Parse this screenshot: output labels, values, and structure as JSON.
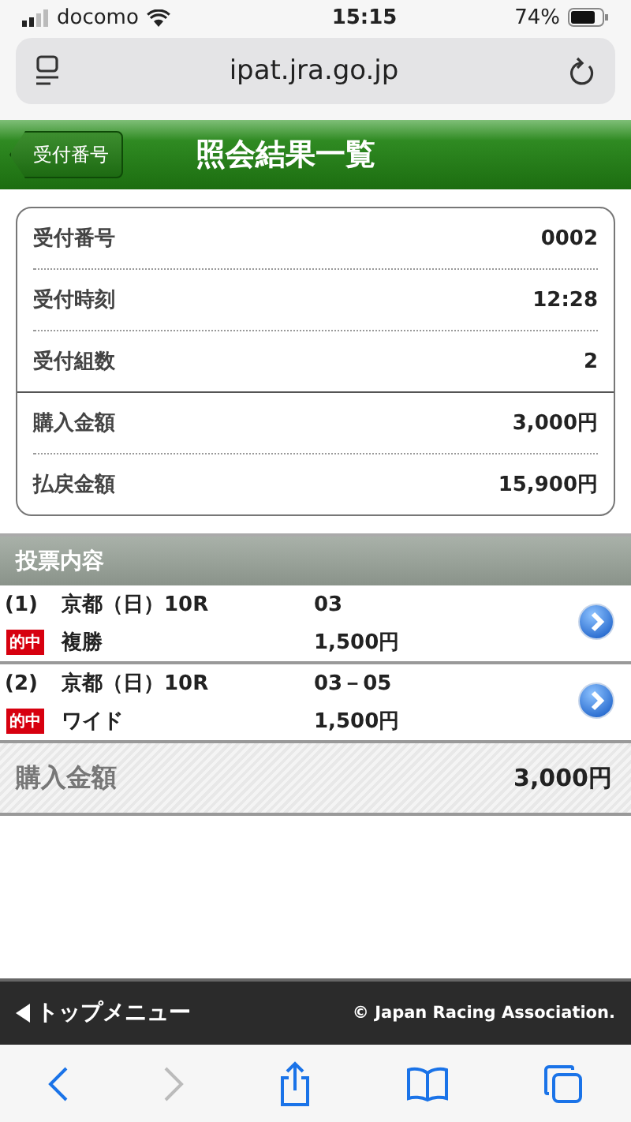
{
  "status_bar": {
    "carrier": "docomo",
    "time": "15:15",
    "battery": "74%"
  },
  "address_bar": {
    "url": "ipat.jra.go.jp"
  },
  "header": {
    "back_button": "受付番号",
    "title": "照会結果一覧"
  },
  "summary": {
    "reception": [
      {
        "label": "受付番号",
        "value": "0002"
      },
      {
        "label": "受付時刻",
        "value": "12:28"
      },
      {
        "label": "受付組数",
        "value": "2"
      }
    ],
    "amounts": [
      {
        "label": "購入金額",
        "value": "3,000円"
      },
      {
        "label": "払戻金額",
        "value": "15,900円"
      }
    ]
  },
  "section_title": "投票内容",
  "bets": [
    {
      "number": "(1)",
      "race": "京都（日）10R",
      "badge": "的中",
      "bet_type": "複勝",
      "combination": "03",
      "amount": "1,500円"
    },
    {
      "number": "(2)",
      "race": "京都（日）10R",
      "badge": "的中",
      "bet_type": "ワイド",
      "combination": "03－05",
      "amount": "1,500円"
    }
  ],
  "total": {
    "label": "購入金額",
    "value": "3,000円"
  },
  "footer": {
    "menu_link": "トップメニュー",
    "copyright": "© Japan Racing Association."
  },
  "toolbar": [
    {
      "kind": "back",
      "disabled": false
    },
    {
      "kind": "forward",
      "disabled": true
    },
    {
      "kind": "share",
      "disabled": false
    },
    {
      "kind": "bookmarks",
      "disabled": false
    },
    {
      "kind": "tabs",
      "disabled": false
    }
  ]
}
